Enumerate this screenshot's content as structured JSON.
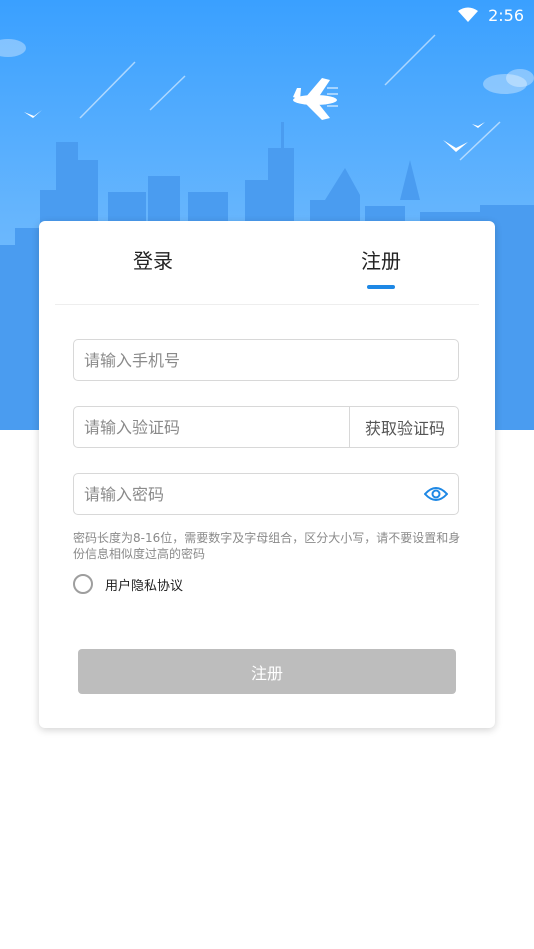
{
  "status_bar": {
    "time": "2:56"
  },
  "tabs": [
    {
      "label": "登录",
      "active": false
    },
    {
      "label": "注册",
      "active": true
    }
  ],
  "form": {
    "phone": {
      "placeholder": "请输入手机号",
      "value": ""
    },
    "code": {
      "placeholder": "请输入验证码",
      "value": "",
      "get_code_label": "获取验证码"
    },
    "password": {
      "placeholder": "请输入密码",
      "value": ""
    },
    "hint": "密码长度为8-16位，需要数字及字母组合，区分大小写，请不要设置和身份信息相似度过高的密码",
    "agreement_label": "用户隐私协议",
    "agreement_checked": false,
    "submit_label": "注册"
  },
  "colors": {
    "sky_top": "#3aa0ff",
    "sky_bottom": "#8cc8fb",
    "building": "#4a9cf0",
    "accent": "#1e88e5",
    "button_disabled": "#bdbdbd"
  },
  "icons": [
    "wifi-icon",
    "airplane-icon",
    "bird-icon",
    "cloud-icon",
    "eye-icon"
  ]
}
